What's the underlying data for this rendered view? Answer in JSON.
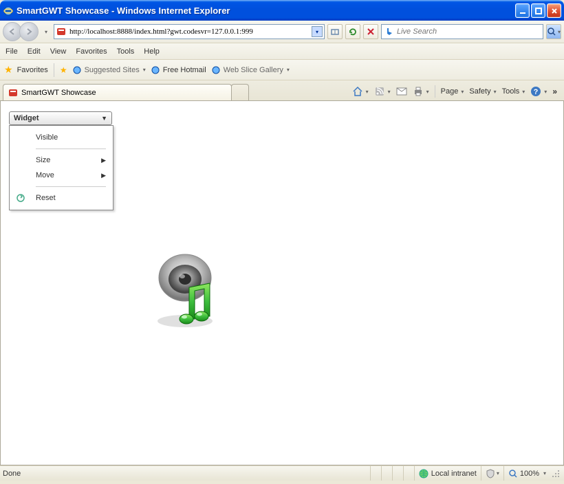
{
  "window": {
    "title": "SmartGWT Showcase - Windows Internet Explorer"
  },
  "address": {
    "url": "http://localhost:8888/index.html?gwt.codesvr=127.0.0.1:999"
  },
  "search": {
    "placeholder": "Live Search"
  },
  "menu": {
    "file": "File",
    "edit": "Edit",
    "view": "View",
    "favorites": "Favorites",
    "tools": "Tools",
    "help": "Help"
  },
  "favbar": {
    "favorites_label": "Favorites",
    "suggested": "Suggested Sites",
    "freehotmail": "Free Hotmail",
    "webslice": "Web Slice Gallery"
  },
  "tab": {
    "title": "SmartGWT Showcase"
  },
  "command_bar": {
    "page": "Page",
    "safety": "Safety",
    "tools": "Tools"
  },
  "widget": {
    "button_label": "Widget",
    "menu": {
      "visible": "Visible",
      "size": "Size",
      "move": "Move",
      "reset": "Reset"
    }
  },
  "status": {
    "left": "Done",
    "zone": "Local intranet",
    "zoom": "100%"
  }
}
